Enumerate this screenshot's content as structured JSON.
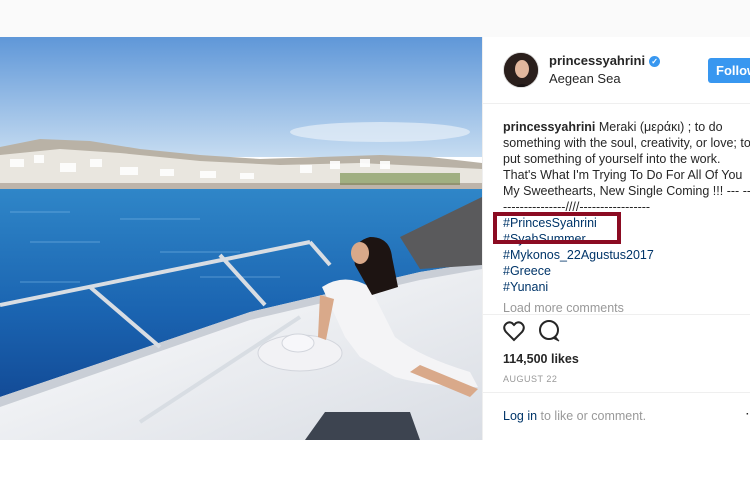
{
  "post": {
    "username": "princessyahrini",
    "location": "Aegean Sea",
    "follow_label": "Follow",
    "caption_lines": [
      "Meraki (μεράκι) ; to do",
      "something with the soul, creativity, or love;",
      "to put something of yourself into the work.",
      "That's What I'm Trying To Do For All Of You",
      "My Sweethearts, New Single Coming !!! ---",
      "-----------------////-----------------"
    ],
    "hashtags": [
      "#PrincesSyahrini",
      "#SyahSummer",
      "#Mykonos_22Agustus2017",
      "#Greece",
      "#Yunani"
    ],
    "load_more": "Load more comments",
    "likes": "114,500 likes",
    "date": "AUGUST 22",
    "comment_link": "Log in",
    "comment_text": " to like or comment."
  },
  "icons": {
    "verified": "verified-badge-icon",
    "like": "heart-icon",
    "comment": "comment-bubble-icon",
    "more": "more-options-icon"
  },
  "colors": {
    "accent": "#3897f0",
    "highlight_box": "#8b0b22",
    "link": "#003569"
  }
}
